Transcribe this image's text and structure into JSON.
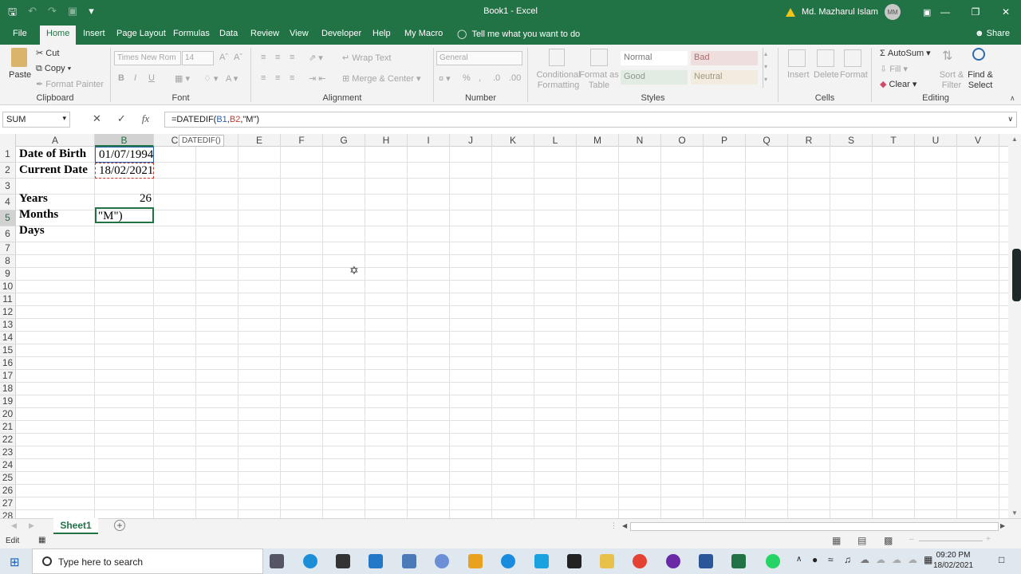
{
  "app": {
    "title": "Book1  -  Excel",
    "user": "Md. Mazharul Islam",
    "user_initials": "MM"
  },
  "tabs": [
    "File",
    "Home",
    "Insert",
    "Page Layout",
    "Formulas",
    "Data",
    "Review",
    "View",
    "Developer",
    "Help",
    "My Macro"
  ],
  "active_tab": "Home",
  "tell_me": "Tell me what you want to do",
  "share": "Share",
  "ribbon": {
    "clipboard": {
      "paste": "Paste",
      "cut": "Cut",
      "copy": "Copy",
      "format_painter": "Format Painter",
      "label": "Clipboard"
    },
    "font": {
      "name": "Times New Rom",
      "size": "14",
      "label": "Font"
    },
    "alignment": {
      "wrap": "Wrap Text",
      "merge": "Merge & Center",
      "label": "Alignment"
    },
    "number": {
      "format": "General",
      "label": "Number"
    },
    "styles": {
      "conditional": "Conditional Formatting",
      "format_as_table": "Format as Table",
      "normal": "Normal",
      "bad": "Bad",
      "good": "Good",
      "neutral": "Neutral",
      "label": "Styles"
    },
    "cells": {
      "insert": "Insert",
      "delete": "Delete",
      "format": "Format",
      "label": "Cells"
    },
    "editing": {
      "autosum": "AutoSum",
      "fill": "Fill",
      "clear": "Clear",
      "sort": "Sort & Filter",
      "find": "Find & Select",
      "label": "Editing"
    }
  },
  "formula_bar": {
    "name_box": "SUM",
    "fx": "fx",
    "formula_prefix": "=DATEDIF(",
    "ref1": "B1",
    "comma1": ",",
    "ref2": "B2",
    "formula_suffix": ",\"M\")"
  },
  "tooltip": "DATEDIF()",
  "columns": [
    "A",
    "B",
    "C",
    "D",
    "E",
    "F",
    "G",
    "H",
    "I",
    "J",
    "K",
    "L",
    "M",
    "N",
    "O",
    "P",
    "Q",
    "R",
    "S",
    "T",
    "U",
    "V"
  ],
  "selected_column": "B",
  "rows": [
    "1",
    "2",
    "3",
    "4",
    "5",
    "6",
    "7",
    "8",
    "9",
    "10",
    "11",
    "12",
    "13",
    "14",
    "15",
    "16",
    "17",
    "18",
    "19",
    "20",
    "21",
    "22",
    "23",
    "24",
    "25",
    "26",
    "27",
    "28"
  ],
  "selected_row": "5",
  "cells": {
    "A1": "Date of Birth",
    "B1": "01/07/1994",
    "A2": "Current Date",
    "B2": "18/02/2021",
    "A4": "Years",
    "B4": "26",
    "A5": "Months",
    "B5": "\"M\")",
    "A6": "Days"
  },
  "sheet_tab": "Sheet1",
  "status": {
    "mode": "Edit"
  },
  "taskbar": {
    "search_placeholder": "Type here to search",
    "time": "09:20 PM",
    "date": "18/02/2021"
  },
  "colors": {
    "accent": "#217346",
    "ref1": "#2a5fb0",
    "ref2": "#c0392b"
  }
}
